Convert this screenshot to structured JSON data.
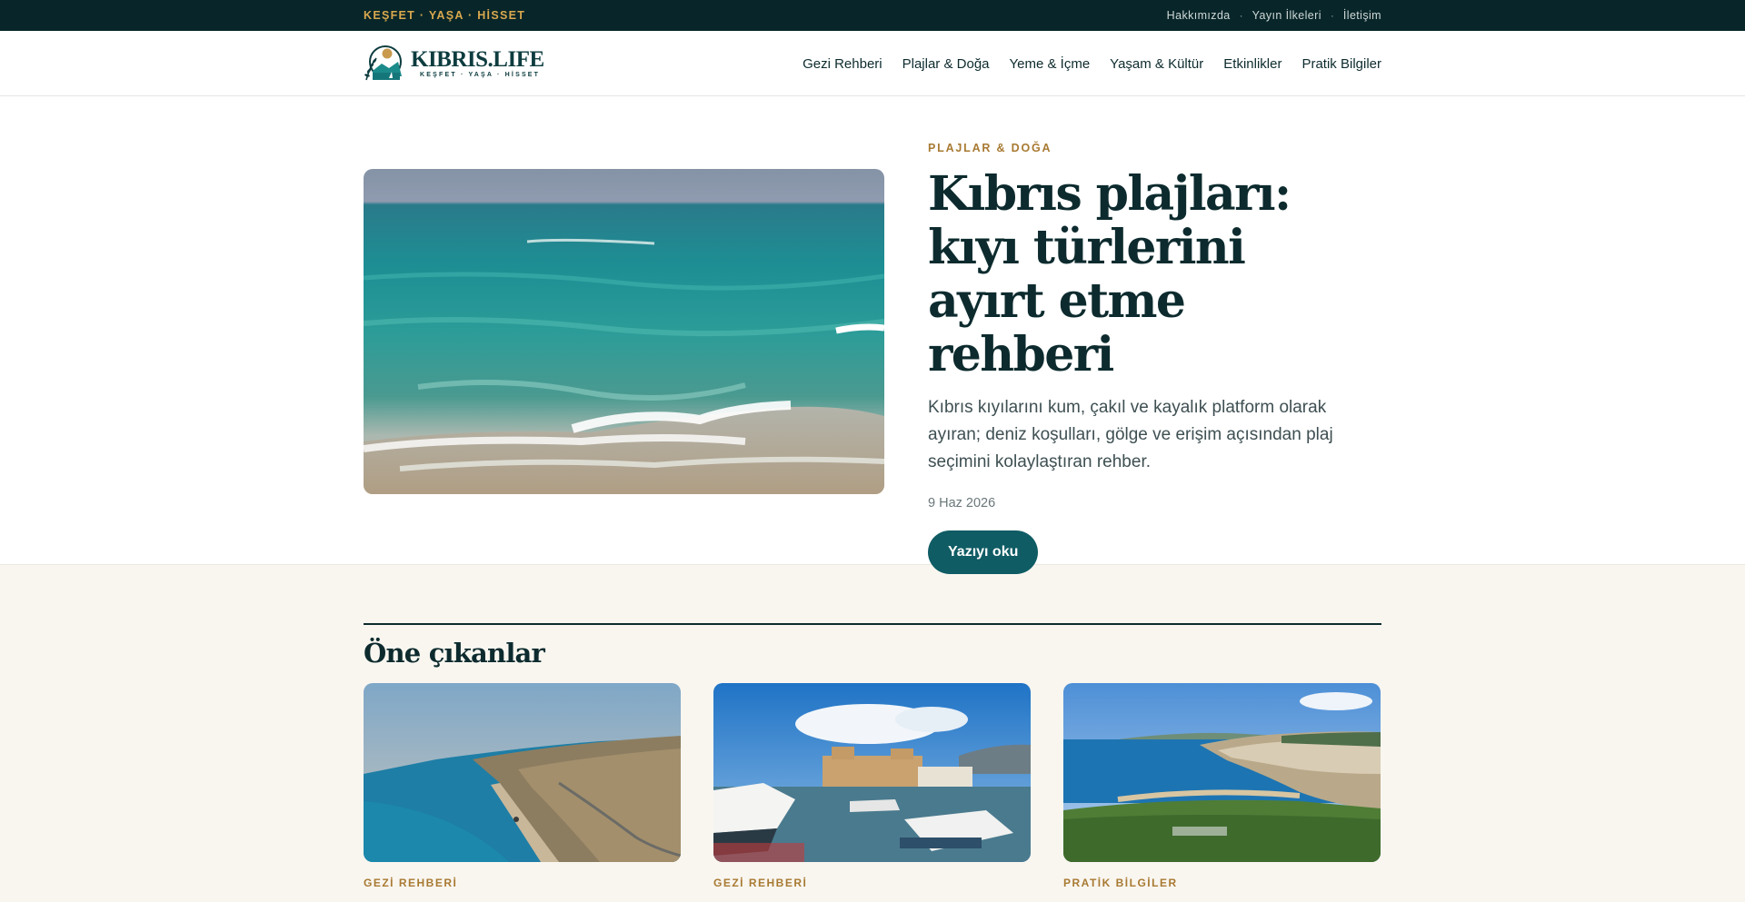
{
  "topbar": {
    "tagline": "KEŞFET · YAŞA · HİSSET",
    "links": [
      "Hakkımızda",
      "Yayın İlkeleri",
      "İletişim"
    ],
    "separator": "·"
  },
  "header": {
    "logo_name": "KIBRIS.LIFE",
    "logo_sub": "KEŞFET · YAŞA · HİSSET",
    "nav": [
      "Gezi Rehberi",
      "Plajlar & Doğa",
      "Yeme & İçme",
      "Yaşam & Kültür",
      "Etkinlikler",
      "Pratik Bilgiler"
    ]
  },
  "hero": {
    "category": "PLAJLAR & DOĞA",
    "title": "Kıbrıs plajları: kıyı türlerini ayırt etme rehberi",
    "description": "Kıbrıs kıyılarını kum, çakıl ve kayalık platform olarak ayıran; deniz koşulları, gölge ve erişim açısından plaj seçimini kolaylaştıran rehber.",
    "date": "9 Haz 2026",
    "cta": "Yazıyı oku"
  },
  "featured": {
    "title": "Öne çıkanlar",
    "cards": [
      {
        "category": "GEZİ REHBERİ"
      },
      {
        "category": "GEZİ REHBERİ"
      },
      {
        "category": "PRATİK BİLGİLER"
      }
    ]
  },
  "colors": {
    "topbar_bg": "#082629",
    "accent_gold": "#a87a32",
    "brand_teal": "#0f5c64",
    "cream_bg": "#f9f6f0"
  }
}
